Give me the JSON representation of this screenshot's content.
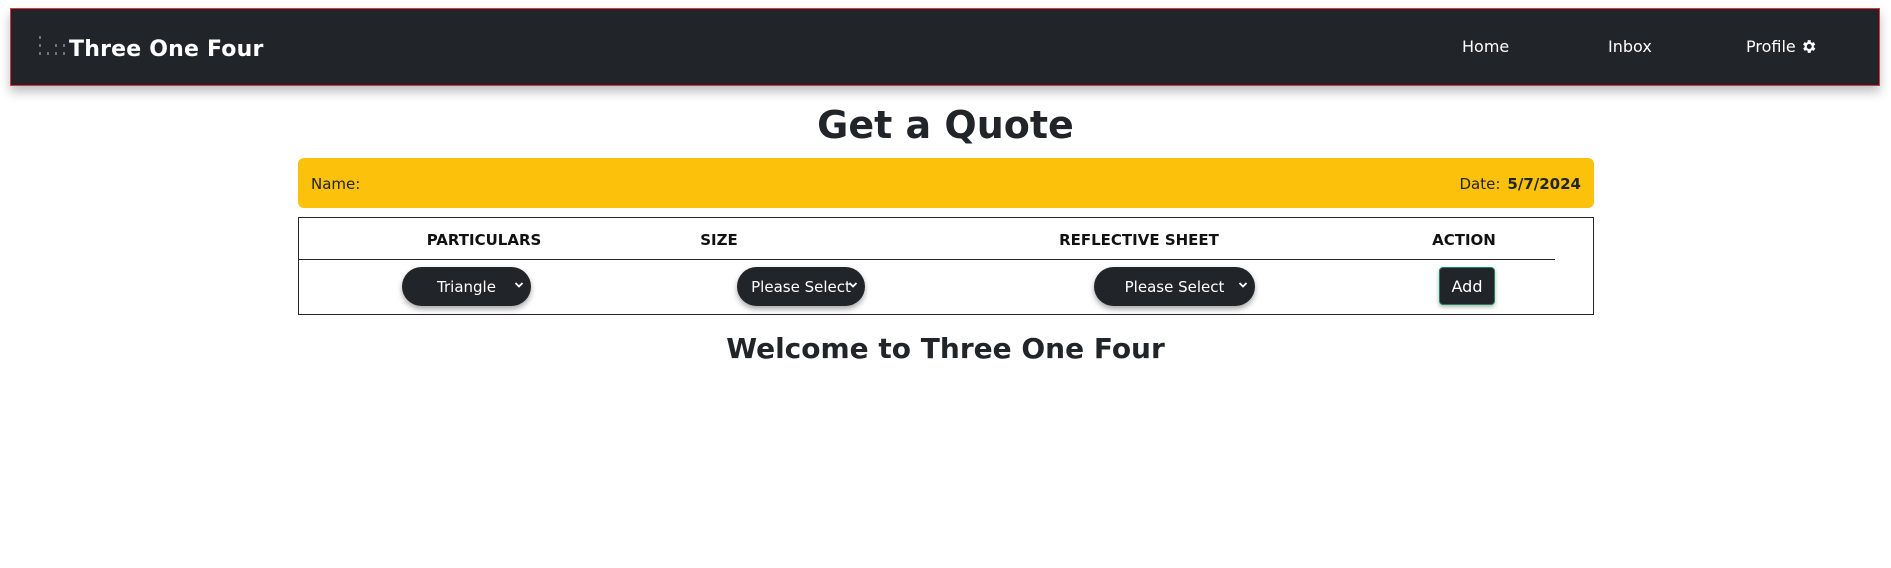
{
  "navbar": {
    "brand": "Three One Four",
    "links": [
      {
        "label": "Home"
      },
      {
        "label": "Inbox"
      },
      {
        "label": "Profile"
      }
    ],
    "colors": {
      "background": "#212529",
      "border": "#dc3545"
    }
  },
  "page": {
    "title": "Get a Quote",
    "welcome": "Welcome to Three One Four"
  },
  "info_bar": {
    "name_label": "Name:",
    "date_label": "Date:",
    "date_value": "5/7/2024",
    "color": "#fcc10a"
  },
  "table": {
    "headers": [
      "PARTICULARS",
      "SIZE",
      "REFLECTIVE SHEET",
      "ACTION"
    ],
    "row": {
      "particulars": "Triangle",
      "size": "Please Select",
      "reflective_sheet": "Please Select",
      "action_label": "Add"
    }
  },
  "icons": {
    "profile": "gear-icon",
    "select_arrow": "chevron-down-icon",
    "logo": "dots-logo-icon"
  }
}
